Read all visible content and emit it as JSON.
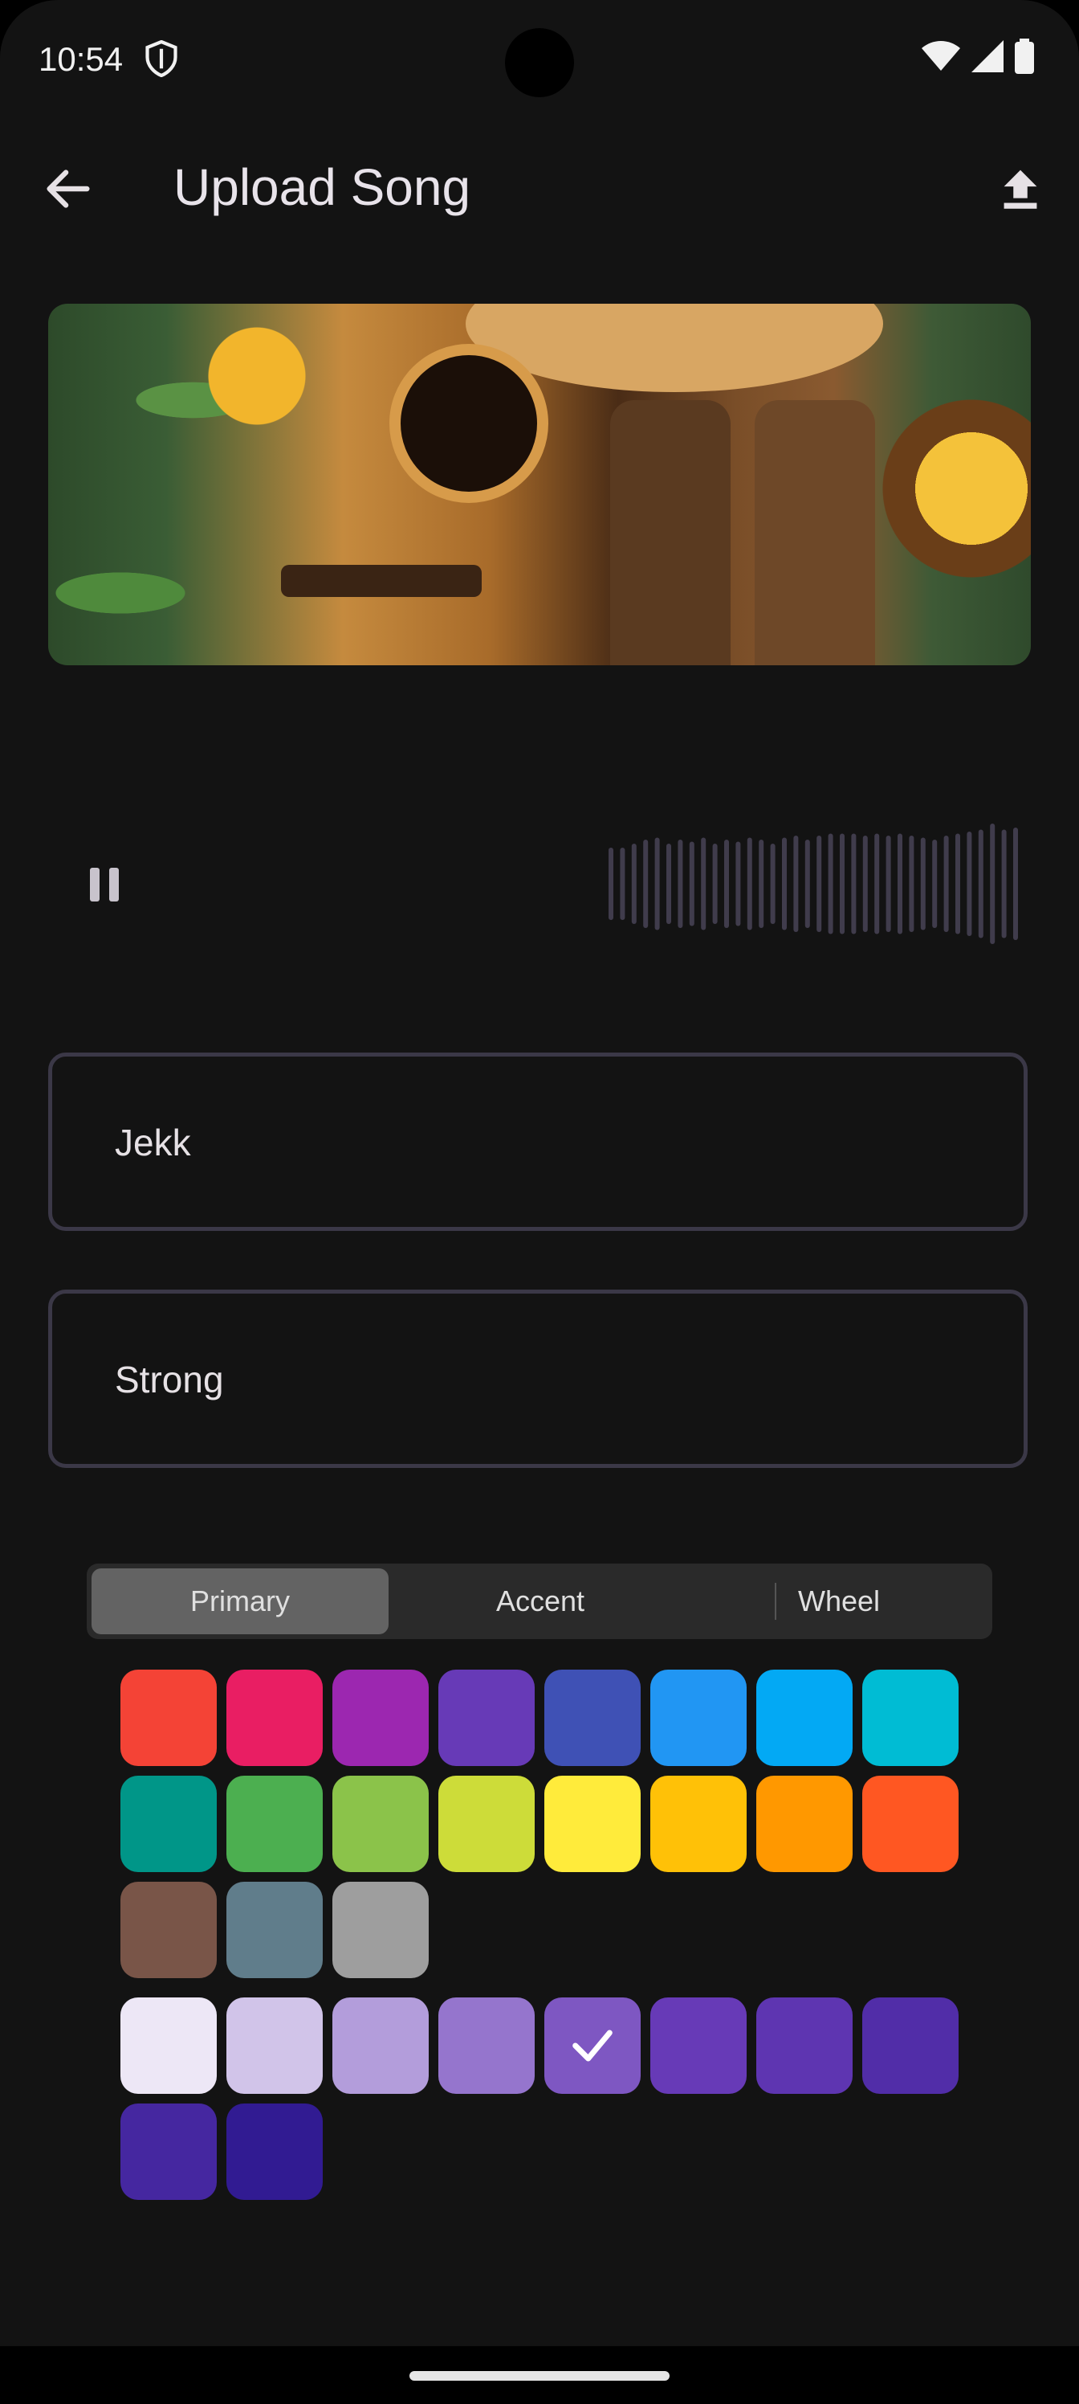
{
  "status_bar": {
    "time": "10:54"
  },
  "app_bar": {
    "title": "Upload Song"
  },
  "form": {
    "artist_value": "Jekk",
    "title_value": "Strong"
  },
  "color_picker": {
    "tabs": [
      {
        "label": "Primary",
        "selected": true
      },
      {
        "label": "Accent",
        "selected": false
      },
      {
        "label": "Wheel",
        "selected": false
      }
    ],
    "primary_colors": [
      "#f44336",
      "#e91e63",
      "#9c27b0",
      "#673ab7",
      "#3f51b5",
      "#2196f3",
      "#03a9f4",
      "#00bcd4",
      "#009688",
      "#4caf50",
      "#8bc34a",
      "#cddc39",
      "#ffeb3b",
      "#ffc107",
      "#ff9800",
      "#ff5722",
      "#795548",
      "#607d8b",
      "#9e9e9e"
    ],
    "shades": [
      "#ede7f6",
      "#d1c4e9",
      "#b39ddb",
      "#9575cd",
      "#7e57c2",
      "#673ab7",
      "#5e35b1",
      "#512da8",
      "#4527a0",
      "#311b92"
    ],
    "selected_shade": "#7e57c2"
  }
}
